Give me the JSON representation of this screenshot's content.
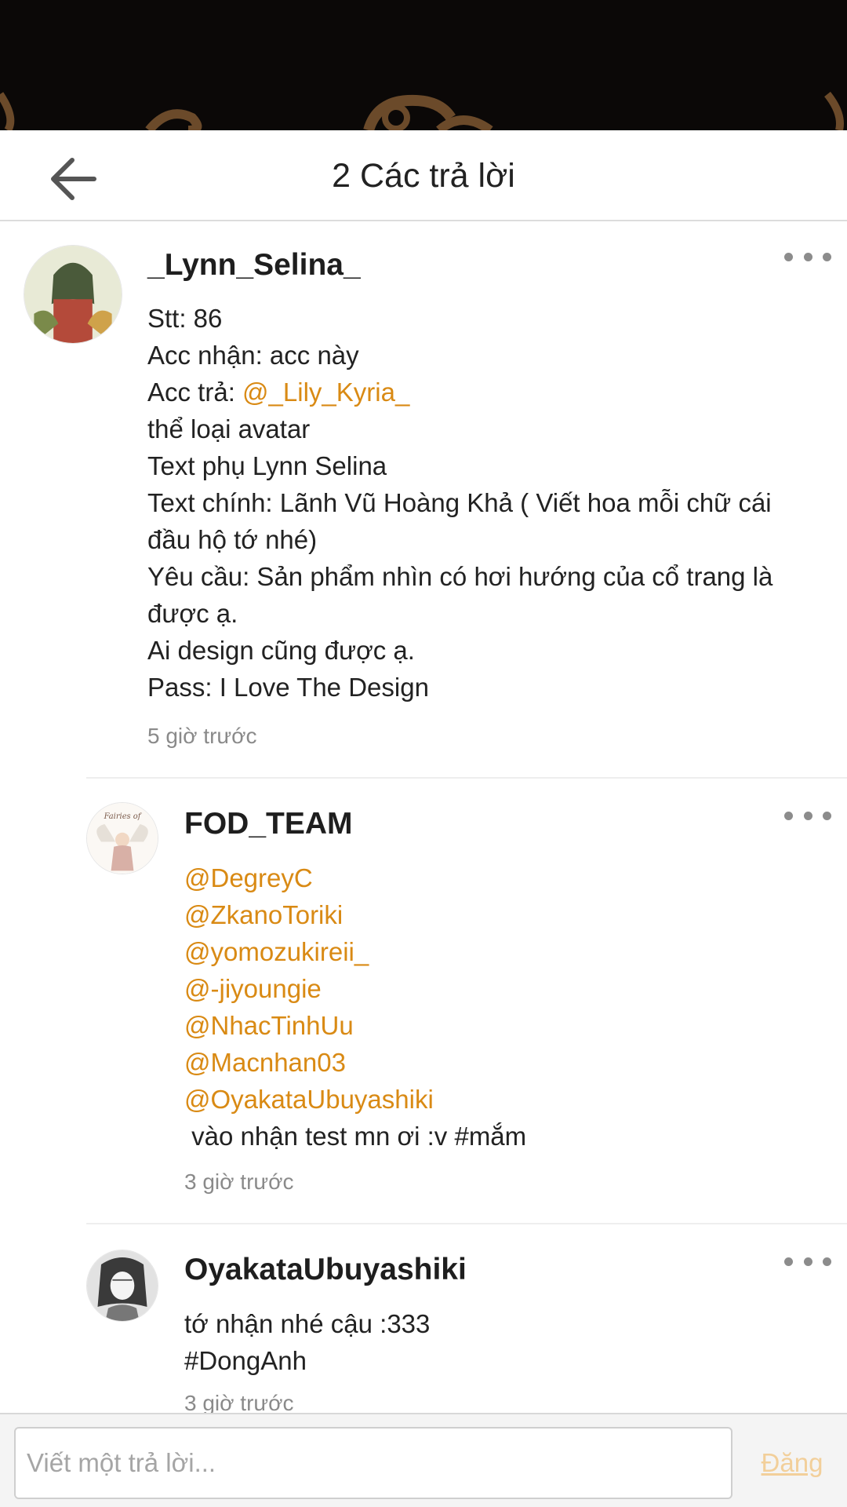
{
  "header": {
    "title": "2 Các trả lời",
    "back_icon": "arrow-left-icon"
  },
  "comments": [
    {
      "username": "_Lynn_Selina_",
      "avatar": "avatar-lynn-selina",
      "lines": [
        {
          "text": "Stt: 86"
        },
        {
          "text": "Acc nhận: acc này"
        },
        {
          "text": "Acc trả: ",
          "mention": "@_Lily_Kyria_"
        },
        {
          "text": "thể loại avatar"
        },
        {
          "text": "Text phụ Lynn Selina"
        },
        {
          "text": "Text chính: Lãnh Vũ Hoàng Khả ( Viết hoa mỗi chữ cái"
        },
        {
          "text": "đầu hộ tớ nhé)"
        },
        {
          "text": "Yêu cầu: Sản phẩm nhìn có hơi hướng của cổ trang là"
        },
        {
          "text": "được ạ."
        },
        {
          "text": "Ai design cũng được ạ."
        },
        {
          "text": "Pass: I Love The Design"
        }
      ],
      "time": "5 giờ trước"
    },
    {
      "username": "FOD_TEAM",
      "avatar": "avatar-fod-team",
      "mentions": [
        "@DegreyC",
        "@ZkanoToriki",
        "@yomozukireii_",
        "@-jiyoungie",
        "@NhacTinhUu",
        "@Macnhan03",
        "@OyakataUbuyashiki"
      ],
      "text_after": " vào nhận test mn ơi :v #mắm",
      "time": "3 giờ trước"
    },
    {
      "username": "OyakataUbuyashiki",
      "avatar": "avatar-oyakata",
      "lines": [
        "tớ nhận nhé cậu :333",
        "#DongAnh"
      ],
      "time": "3 giờ trước"
    }
  ],
  "reply_bar": {
    "placeholder": "Viết một trả lời...",
    "post_label": "Đăng"
  },
  "colors": {
    "mention": "#d98a14",
    "post_disabled": "#f2cf9a",
    "cover": "#0b0807"
  }
}
